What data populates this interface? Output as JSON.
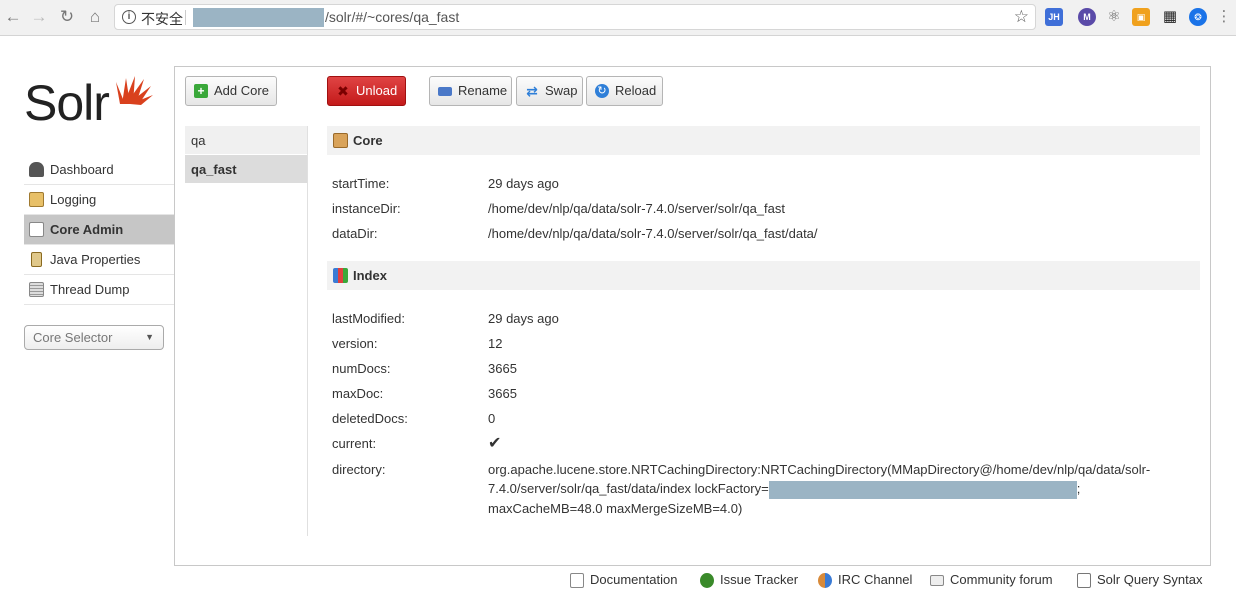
{
  "browser": {
    "insecure_label": "不安全",
    "url_path": "/solr/#/~cores/qa_fast",
    "extensions": [
      "JH",
      "M",
      "⚛",
      "▣",
      "▦",
      "❂"
    ]
  },
  "logo": {
    "text": "Solr"
  },
  "nav": {
    "items": [
      {
        "label": "Dashboard",
        "icon": "dashboard-icon"
      },
      {
        "label": "Logging",
        "icon": "logging-icon"
      },
      {
        "label": "Core Admin",
        "icon": "core-admin-icon",
        "active": true
      },
      {
        "label": "Java Properties",
        "icon": "java-icon"
      },
      {
        "label": "Thread Dump",
        "icon": "thread-dump-icon"
      }
    ],
    "core_selector": "Core Selector"
  },
  "toolbar": {
    "add_core": "Add Core",
    "unload": "Unload",
    "rename": "Rename",
    "swap": "Swap",
    "reload": "Reload"
  },
  "cores": [
    {
      "name": "qa",
      "active": false
    },
    {
      "name": "qa_fast",
      "active": true
    }
  ],
  "core_section": {
    "title": "Core",
    "rows": [
      {
        "key": "startTime:",
        "value": "29 days ago"
      },
      {
        "key": "instanceDir:",
        "value": "/home/dev/nlp/qa/data/solr-7.4.0/server/solr/qa_fast"
      },
      {
        "key": "dataDir:",
        "value": "/home/dev/nlp/qa/data/solr-7.4.0/server/solr/qa_fast/data/"
      }
    ]
  },
  "index_section": {
    "title": "Index",
    "rows": [
      {
        "key": "lastModified:",
        "value": "29 days ago"
      },
      {
        "key": "version:",
        "value": "12"
      },
      {
        "key": "numDocs:",
        "value": "3665"
      },
      {
        "key": "maxDoc:",
        "value": "3665"
      },
      {
        "key": "deletedDocs:",
        "value": "0"
      },
      {
        "key": "current:",
        "value": "✔"
      }
    ],
    "directory": {
      "key": "directory:",
      "line1": "org.apache.lucene.store.NRTCachingDirectory:NRTCachingDirectory(MMapDirectory@/home/dev/nlp/qa/data/solr-",
      "line2_prefix": "7.4.0/server/solr/qa_fast/data/index lockFactory=",
      "line2_suffix": ";",
      "line3": "maxCacheMB=48.0 maxMergeSizeMB=4.0)"
    }
  },
  "footer": {
    "links": [
      "Documentation",
      "Issue Tracker",
      "IRC Channel",
      "Community forum",
      "Solr Query Syntax"
    ]
  }
}
